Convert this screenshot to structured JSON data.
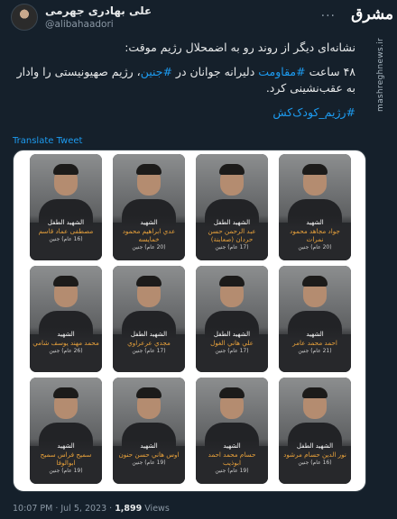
{
  "author": {
    "display_name": "علی بهادری جهرمی",
    "handle": "@alibahaadori",
    "menu_icon": "more-dots-icon"
  },
  "watermark": {
    "logo_text": "مشرق",
    "url": "mashreghnews.ir"
  },
  "tweet": {
    "line1": "نشانه‌ای دیگر از روند رو به اضمحلال رژیم موقت:",
    "line2_prefix": "۴۸ ساعت ",
    "line2_tag1": "#مقاومت",
    "line2_mid": " دلیرانه جوانان در ",
    "line2_tag2": "#جنین",
    "line2_suffix": "، رژیم صهیونیستی را وادار به عقب‌نشینی کرد.",
    "hashtag": "#رژیم_کودک‌کش",
    "translate": "Translate Tweet"
  },
  "cards": [
    {
      "badge": "الشهيد الطفل",
      "name": "مصطفى عماد قاسم",
      "info": "(16 عام) جنين"
    },
    {
      "badge": "الشهيد",
      "name": "عدي ابراهيم محمود خمايسه",
      "info": "(20 عام) جنين"
    },
    {
      "badge": "الشهيد الطفل",
      "name": "عبد الرحمن حسن حردان (صعابنة)",
      "info": "(17 عام) جنين"
    },
    {
      "badge": "الشهيد",
      "name": "جواد مجاهد محمود نمرات",
      "info": "(20 عام) جنين"
    },
    {
      "badge": "الشهيد",
      "name": "محمد مهند يوسف شامي",
      "info": "(26 عام) جنين"
    },
    {
      "badge": "الشهيد الطفل",
      "name": "مجدي عرعراوي",
      "info": "(17 عام) جنين"
    },
    {
      "badge": "الشهيد الطفل",
      "name": "علي هاني الغول",
      "info": "(17 عام) جنين"
    },
    {
      "badge": "الشهيد",
      "name": "احمد محمد عامر",
      "info": "(21 عام) جنين"
    },
    {
      "badge": "الشهيد",
      "name": "سميح فراس سميح ابوالوفا",
      "info": "(19 عام) جنين"
    },
    {
      "badge": "الشهيد",
      "name": "اوس هاني حسن حنون",
      "info": "(19 عام) جنين"
    },
    {
      "badge": "الشهيد",
      "name": "حسام محمد احمد ابوذيب",
      "info": "(19 عام) جنين"
    },
    {
      "badge": "الشهيد الطفل",
      "name": "نور الدين حسام مرشود",
      "info": "(16 عام) جنين"
    }
  ],
  "meta": {
    "time": "10:07 PM · Jul 5, 2023 · ",
    "views_count": "1,899",
    "views_label": " Views"
  },
  "colors": {
    "background": "#15202b",
    "link": "#1d9bf0",
    "name_accent": "#e9a23b"
  }
}
